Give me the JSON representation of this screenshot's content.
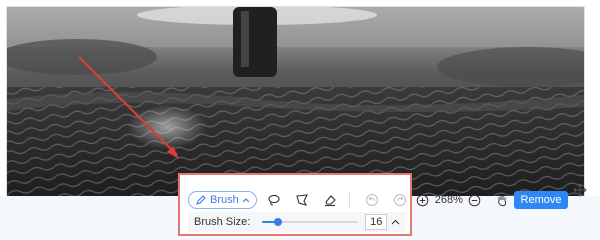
{
  "toolbar": {
    "brush_label": "Brush",
    "zoom_level": "268%",
    "remove_label": "Remove"
  },
  "brush_size": {
    "label": "Brush Size:",
    "value": "16",
    "slider_fraction": 0.16
  },
  "colors": {
    "accent": "#2f86f6",
    "highlight_box": "#e87575",
    "annotation_arrow": "#e03a3a"
  },
  "icons": [
    "brush-icon",
    "lasso-icon",
    "polygon-lasso-icon",
    "eraser-icon",
    "undo-icon",
    "redo-icon",
    "zoom-in-icon",
    "zoom-out-icon",
    "hand-icon",
    "move-icon"
  ]
}
